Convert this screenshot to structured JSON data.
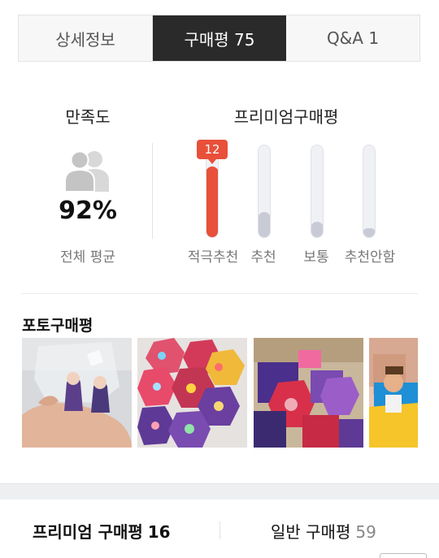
{
  "tabs": [
    {
      "label": "상세정보",
      "active": false
    },
    {
      "label": "구매평 75",
      "active": true
    },
    {
      "label": "Q&A 1",
      "active": false
    }
  ],
  "satisfaction": {
    "title": "만족도",
    "icon": "people-icon",
    "value": "92%",
    "subtitle": "전체 평균"
  },
  "premium_reviews": {
    "title": "프리미엄구매평",
    "bars": [
      {
        "label": "적극추천",
        "count": "12",
        "fill": 0.78,
        "highlight": true
      },
      {
        "label": "추천",
        "fill": 0.28,
        "highlight": false
      },
      {
        "label": "보통",
        "fill": 0.18,
        "highlight": false
      },
      {
        "label": "추천안함",
        "fill": 0.11,
        "highlight": false
      }
    ]
  },
  "photo_reviews": {
    "title": "포토구매평",
    "photos": [
      "photo-review-1",
      "photo-review-2",
      "photo-review-3",
      "photo-review-4"
    ]
  },
  "summary": {
    "premium_label": "프리미엄 구매평",
    "premium_count": "16",
    "general_label": "일반 구매평",
    "general_count": "59"
  },
  "colors": {
    "accent": "#e8503a",
    "active_tab_bg": "#2a2a2a",
    "bar_inactive": "#c8cbd6"
  }
}
